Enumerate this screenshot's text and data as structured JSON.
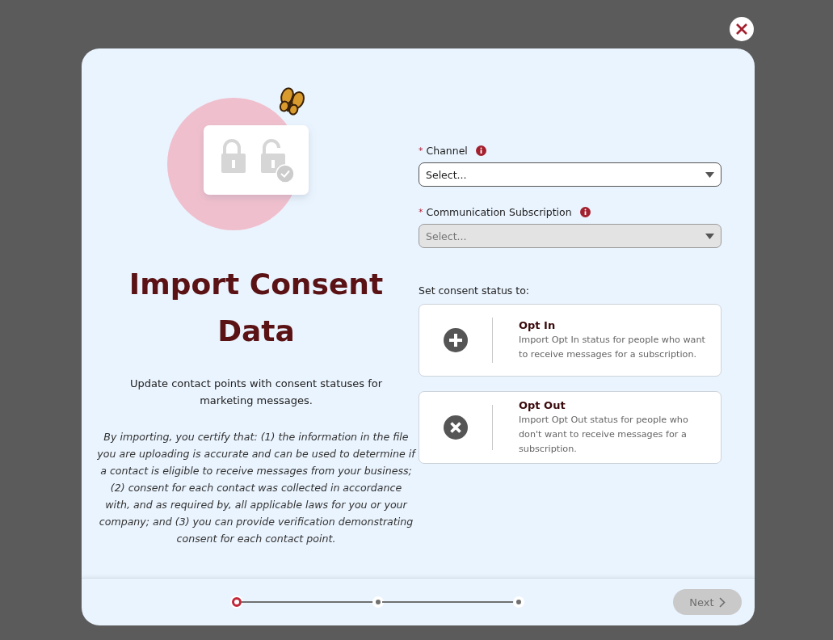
{
  "title": "Import Consent Data",
  "description": "Update contact points with consent statuses for marketing messages.",
  "disclaimer": "By importing, you certify that: (1) the information in the file you are uploading is accurate and can be used to determine if a contact is eligible to receive messages from your business; (2) consent for each contact was collected in accordance with, and as required by, all applicable laws for you or your company; and (3) you can provide verification demonstrating consent for each contact point.",
  "fields": [
    {
      "required_mark": "*",
      "label": "Channel",
      "placeholder": "Select...",
      "disabled": false
    },
    {
      "required_mark": "*",
      "label": "Communication Subscription",
      "placeholder": "Select...",
      "disabled": true
    }
  ],
  "status_prompt": "Set consent status to:",
  "options": [
    {
      "kind": "add",
      "title": "Opt In",
      "description": "Import Opt In status for people who want to receive messages for a subscription.",
      "selected": false
    },
    {
      "kind": "remove",
      "title": "Opt Out",
      "description": "Import Opt Out status for people who don't want to receive messages for a subscription.",
      "selected": false
    }
  ],
  "steps": [
    {
      "selected": true
    },
    {
      "selected": false
    },
    {
      "selected": false
    }
  ],
  "next_button": {
    "label": "Next",
    "disabled": true
  }
}
